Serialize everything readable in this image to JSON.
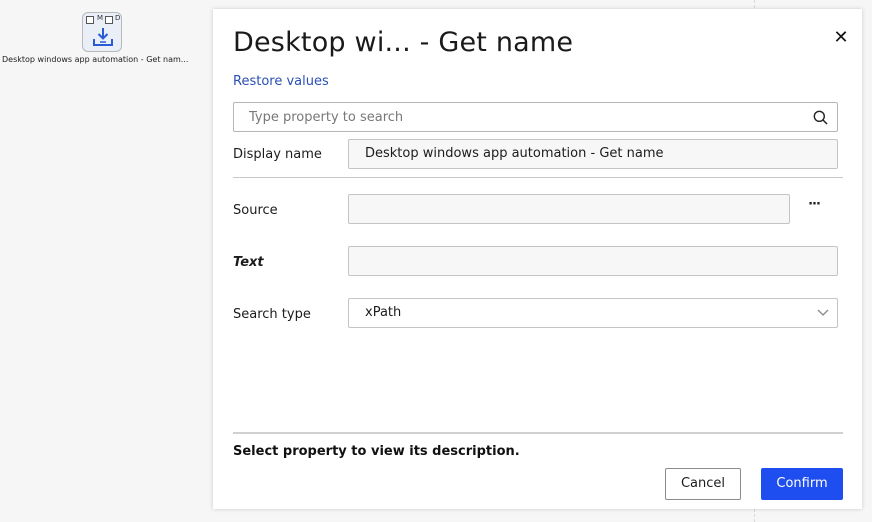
{
  "canvas": {
    "node": {
      "icon": "download-tray-icon",
      "checkbox_labels": [
        "M",
        "D"
      ],
      "label": "Desktop windows app automation - Get nam..."
    }
  },
  "dialog": {
    "title": "Desktop wi... - Get name",
    "close_label": "✕",
    "restore_label": "Restore values",
    "search": {
      "placeholder": "Type property to search",
      "value": ""
    },
    "properties": {
      "display_name": {
        "label": "Display name",
        "value": "Desktop windows app automation - Get name"
      },
      "source": {
        "label": "Source",
        "value": "",
        "browse_label": "···"
      },
      "text": {
        "label": "Text",
        "value": ""
      },
      "search_type": {
        "label": "Search type",
        "value": "xPath"
      }
    },
    "description": "Select property to view its description.",
    "buttons": {
      "cancel": "Cancel",
      "confirm": "Confirm"
    },
    "colors": {
      "accent": "#1f4ef0",
      "link": "#2a4fb7"
    }
  }
}
